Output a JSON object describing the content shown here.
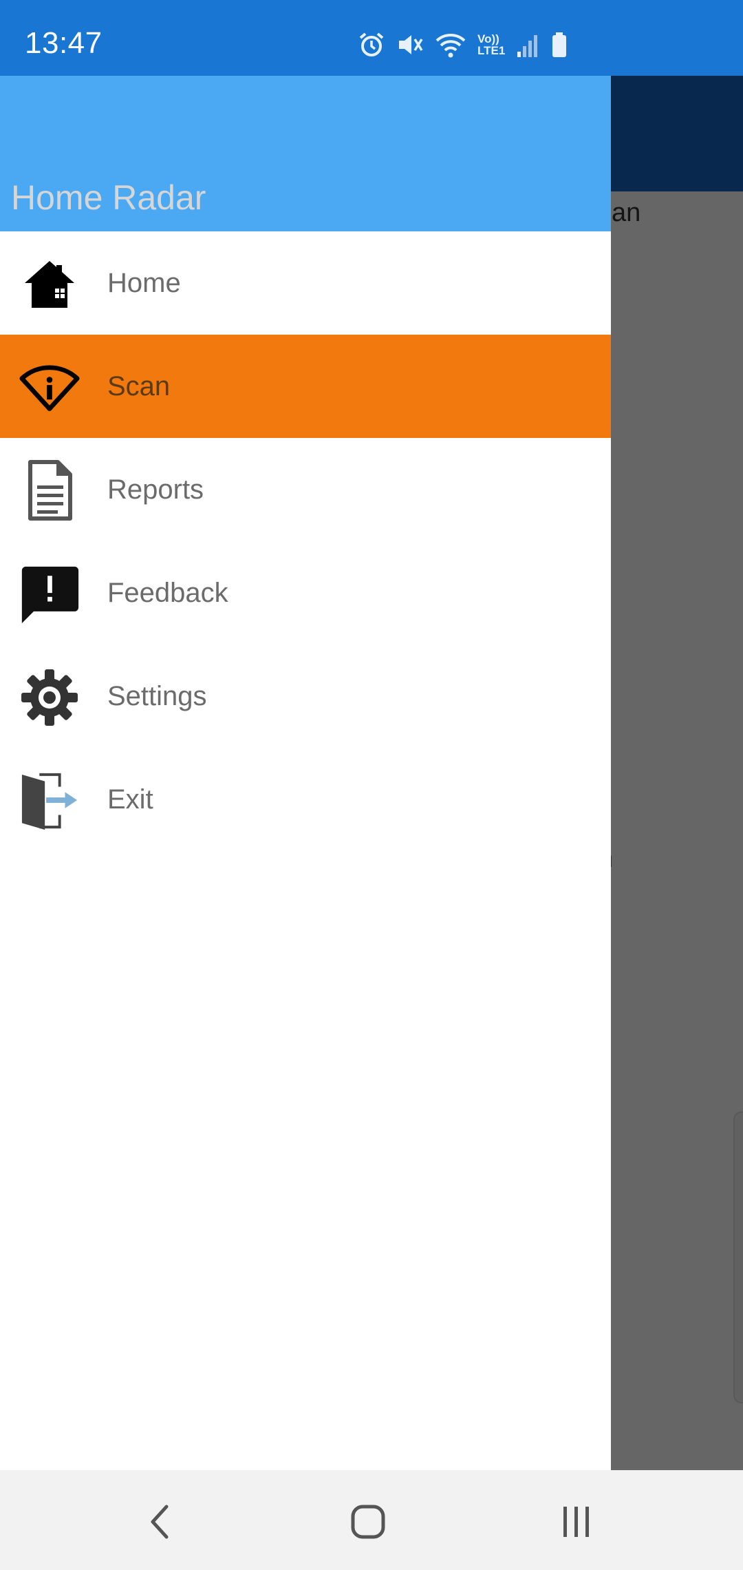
{
  "status_bar": {
    "time": "13:47",
    "icons": [
      "alarm-icon",
      "mute-icon",
      "wifi-icon",
      "volte-icon",
      "signal-icon",
      "battery-icon"
    ],
    "volte_label_top": "Vo))",
    "volte_label_bottom": "LTE1"
  },
  "background_app": {
    "partial_text_1": "can",
    "partial_text_2": "n"
  },
  "drawer": {
    "header_title": "Home Radar",
    "items": [
      {
        "label": "Home",
        "icon": "home-icon",
        "selected": false
      },
      {
        "label": "Scan",
        "icon": "radar-scan-icon",
        "selected": true
      },
      {
        "label": "Reports",
        "icon": "document-icon",
        "selected": false
      },
      {
        "label": "Feedback",
        "icon": "feedback-icon",
        "selected": false
      },
      {
        "label": "Settings",
        "icon": "gear-icon",
        "selected": false
      },
      {
        "label": "Exit",
        "icon": "exit-door-icon",
        "selected": false
      }
    ]
  },
  "nav_bar": {
    "buttons": [
      "back-icon",
      "home-circle-icon",
      "recents-icon"
    ]
  },
  "colors": {
    "status_bar": "#1976d2",
    "drawer_header": "#4aa9f2",
    "selected_item": "#f1790d",
    "scrim": "#666666"
  }
}
